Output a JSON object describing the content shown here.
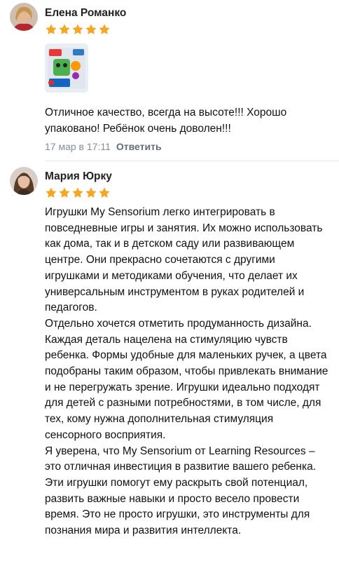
{
  "reviews": [
    {
      "author": "Елена Романко",
      "rating": 5,
      "text": "Отличное качество, всегда на высоте!!! Хорошо упаковано! Ребёнок очень доволен!!!",
      "date": "17 мар в 17:11",
      "reply_label": "Ответить"
    },
    {
      "author": "Мария Юрку",
      "rating": 5,
      "paragraphs": [
        "Игрушки My Sensorium легко интегрировать в повседневные игры и занятия. Их можно использовать как дома, так и в детском саду или развивающем центре. Они прекрасно сочетаются с другими игрушками и методиками обучения, что делает их универсальным инструментом в руках родителей и педагогов.",
        "Отдельно хочется отметить продуманность дизайна. Каждая деталь нацелена на стимуляцию чувств ребенка. Формы удобные для маленьких ручек, а цвета подобраны таким образом, чтобы привлекать внимание и не перегружать зрение. Игрушки идеально подходят для детей с разными потребностями, в том числе, для тех, кому нужна дополнительная стимуляция сенсорного восприятия.",
        "Я уверена, что My Sensorium от Learning Resources – это отличная инвестиция в развитие вашего ребенка. Эти игрушки помогут ему раскрыть свой потенциал, развить важные навыки и просто весело провести время. Это не просто игрушки, это инструменты для познания мира и развития интеллекта."
      ]
    }
  ],
  "colors": {
    "star": "#f5a623",
    "meta": "#818c99",
    "reply": "#626d7a"
  },
  "icons": {
    "star": "star-icon"
  }
}
